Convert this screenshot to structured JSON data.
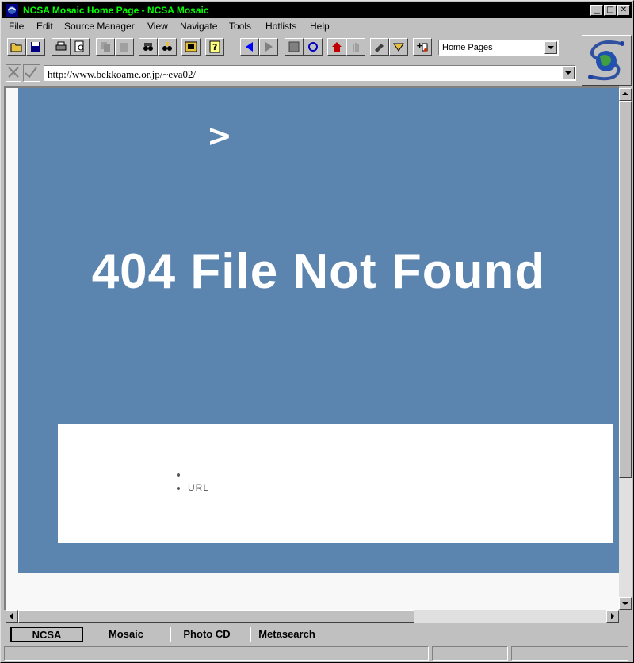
{
  "window": {
    "title": "NCSA Mosaic Home Page - NCSA Mosaic"
  },
  "menu": [
    "File",
    "Edit",
    "Source Manager",
    "View",
    "Navigate",
    "Tools",
    "Hotlists",
    "Help"
  ],
  "home_select": {
    "value": "Home Pages"
  },
  "url": {
    "value": "http://www.bekkoame.or.jp/~eva02/"
  },
  "page": {
    "arrow": ">",
    "heading": "404 File Not Found",
    "list_items": [
      "",
      "URL"
    ]
  },
  "bottom_buttons": [
    "NCSA",
    "Mosaic",
    "Photo CD",
    "Metasearch"
  ],
  "colors": {
    "title_bg": "#000000",
    "title_text": "#00ff00",
    "page_bg": "#5b85af"
  }
}
